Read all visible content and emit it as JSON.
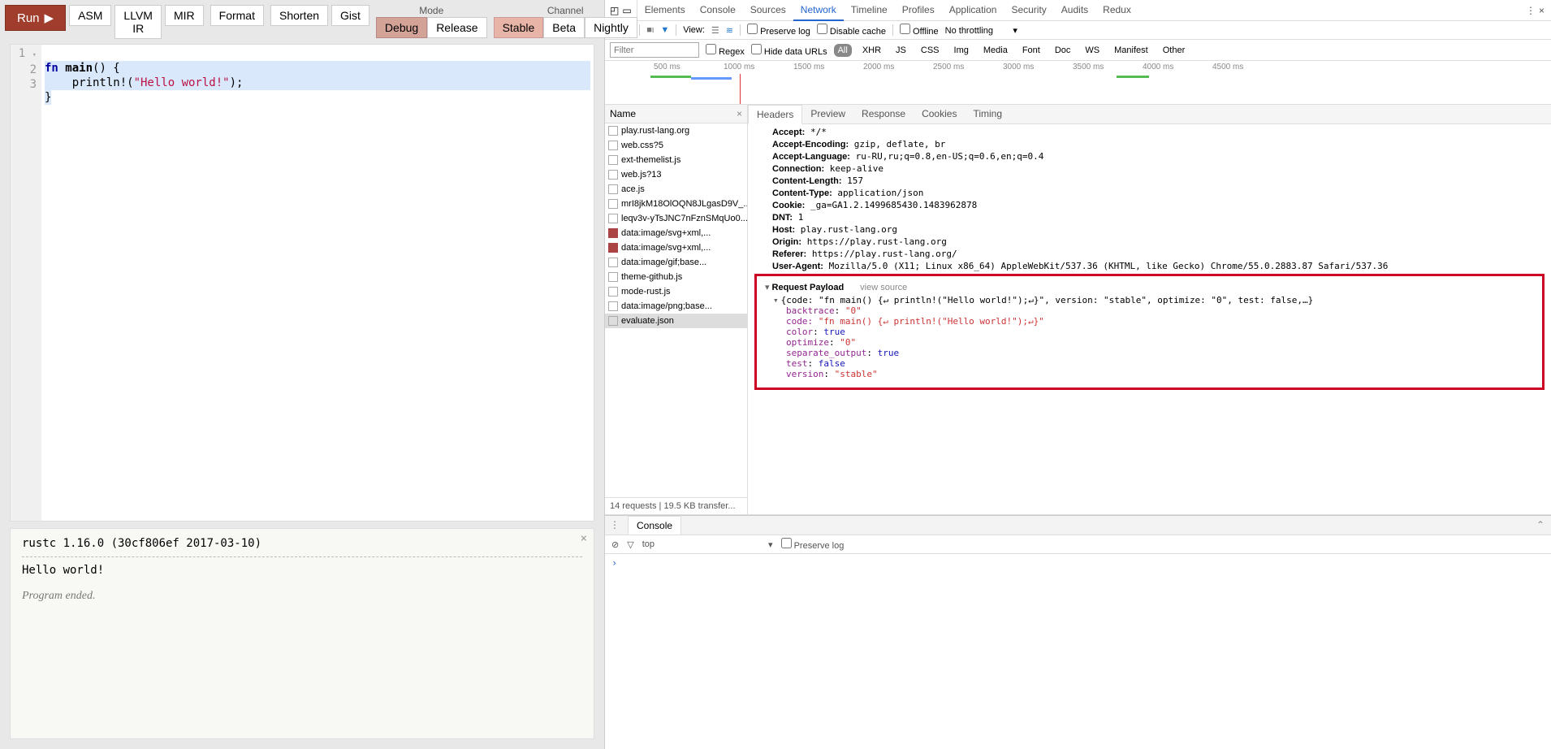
{
  "playground": {
    "run": "Run",
    "buttons": [
      "ASM",
      "LLVM IR",
      "MIR",
      "Format",
      "Shorten",
      "Gist"
    ],
    "mode_label": "Mode",
    "modes": [
      "Debug",
      "Release"
    ],
    "channel_label": "Channel",
    "channels": [
      "Stable",
      "Beta",
      "Nightly"
    ],
    "code_lines": [
      "1",
      "2",
      "3"
    ],
    "code": {
      "l1a": "fn",
      "l1b": " main",
      "l1c": "() {",
      "l2a": "    println!(",
      "l2b": "\"Hello world!\"",
      "l2c": ");",
      "l3": "}"
    },
    "output": {
      "rustc": "rustc 1.16.0 (30cf806ef 2017-03-10)",
      "hello": "Hello world!",
      "ended": "Program ended."
    }
  },
  "devtools": {
    "main_tabs": [
      "Elements",
      "Console",
      "Sources",
      "Network",
      "Timeline",
      "Profiles",
      "Application",
      "Security",
      "Audits",
      "Redux"
    ],
    "net_toolbar": {
      "view": "View:",
      "preserve": "Preserve log",
      "disable_cache": "Disable cache",
      "offline": "Offline",
      "throttle": "No throttling"
    },
    "filter": {
      "placeholder": "Filter",
      "regex": "Regex",
      "hide": "Hide data URLs",
      "types": [
        "All",
        "XHR",
        "JS",
        "CSS",
        "Img",
        "Media",
        "Font",
        "Doc",
        "WS",
        "Manifest",
        "Other"
      ]
    },
    "timeline_ticks": [
      "500 ms",
      "1000 ms",
      "1500 ms",
      "2000 ms",
      "2500 ms",
      "3000 ms",
      "3500 ms",
      "4000 ms",
      "4500 ms"
    ],
    "name_col": "Name",
    "requests": [
      "play.rust-lang.org",
      "web.css?5",
      "ext-themelist.js",
      "web.js?13",
      "ace.js",
      "mrI8jkM18OlOQN8JLgasD9V_...",
      "leqv3v-yTsJNC7nFznSMqUo0...",
      "data:image/svg+xml,...",
      "data:image/svg+xml,...",
      "data:image/gif;base...",
      "theme-github.js",
      "mode-rust.js",
      "data:image/png;base...",
      "evaluate.json"
    ],
    "req_summary": "14 requests   |   19.5 KB transfer...",
    "detail_tabs": [
      "Headers",
      "Preview",
      "Response",
      "Cookies",
      "Timing"
    ],
    "headers": {
      "Accept": "*/*",
      "Accept-Encoding": "gzip, deflate, br",
      "Accept-Language": "ru-RU,ru;q=0.8,en-US;q=0.6,en;q=0.4",
      "Connection": "keep-alive",
      "Content-Length": "157",
      "Content-Type": "application/json",
      "Cookie": "_ga=GA1.2.1499685430.1483962878",
      "DNT": "1",
      "Host": "play.rust-lang.org",
      "Origin": "https://play.rust-lang.org",
      "Referer": "https://play.rust-lang.org/",
      "User-Agent": "Mozilla/5.0 (X11; Linux x86_64) AppleWebKit/537.36 (KHTML, like Gecko) Chrome/55.0.2883.87 Safari/537.36"
    },
    "vs": "view source",
    "payload_title": "Request Payload",
    "payload_summary": "{code: \"fn main() {↵ println!(\"Hello world!\");↵}\", version: \"stable\", optimize: \"0\", test: false,…}",
    "payload": {
      "backtrace": "\"0\"",
      "code_k": "code:",
      "code_v": "\"fn main() {↵    println!(\"Hello world!\");↵}\"",
      "color": "true",
      "optimize": "\"0\"",
      "separate_output": "true",
      "test": "false",
      "version": "\"stable\""
    },
    "console_label": "Console",
    "console_top": "top",
    "preserve_log": "Preserve log",
    "prompt": "›"
  }
}
